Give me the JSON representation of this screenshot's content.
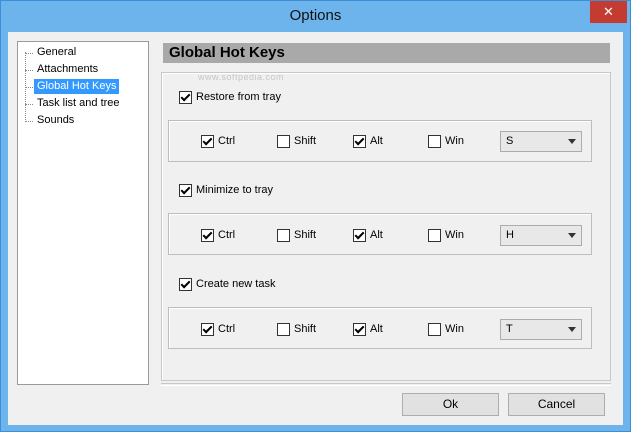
{
  "window": {
    "title": "Options",
    "close_glyph": "✕"
  },
  "tree": {
    "items": [
      {
        "label": "General",
        "selected": false
      },
      {
        "label": "Attachments",
        "selected": false
      },
      {
        "label": "Global Hot Keys",
        "selected": true
      },
      {
        "label": "Task list and tree",
        "selected": false
      },
      {
        "label": "Sounds",
        "selected": false
      }
    ]
  },
  "page": {
    "title": "Global Hot Keys",
    "watermark": "www.softpedia.com"
  },
  "hotkeys": [
    {
      "label": "Restore from tray",
      "enabled": true,
      "ctrl": {
        "label": "Ctrl",
        "checked": true
      },
      "shift": {
        "label": "Shift",
        "checked": false
      },
      "alt": {
        "label": "Alt",
        "checked": true
      },
      "win": {
        "label": "Win",
        "checked": false
      },
      "key": "S"
    },
    {
      "label": "Minimize to tray",
      "enabled": true,
      "ctrl": {
        "label": "Ctrl",
        "checked": true
      },
      "shift": {
        "label": "Shift",
        "checked": false
      },
      "alt": {
        "label": "Alt",
        "checked": true
      },
      "win": {
        "label": "Win",
        "checked": false
      },
      "key": "H"
    },
    {
      "label": "Create new task",
      "enabled": true,
      "ctrl": {
        "label": "Ctrl",
        "checked": true
      },
      "shift": {
        "label": "Shift",
        "checked": false
      },
      "alt": {
        "label": "Alt",
        "checked": true
      },
      "win": {
        "label": "Win",
        "checked": false
      },
      "key": "T"
    }
  ],
  "buttons": {
    "ok": "Ok",
    "cancel": "Cancel"
  },
  "colors": {
    "titlebar": "#6db4ed",
    "selection": "#3399ff",
    "close": "#c43b31"
  }
}
